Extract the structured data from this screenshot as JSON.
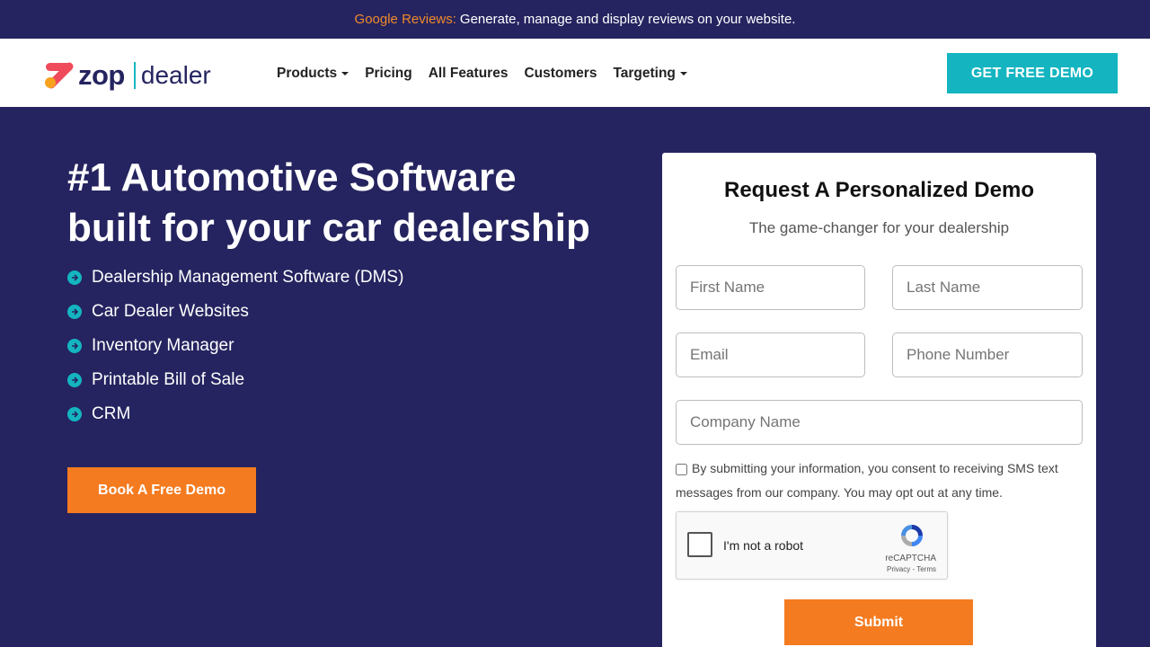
{
  "announcement": {
    "highlight": "Google Reviews:",
    "text": "Generate, manage and display reviews on your website."
  },
  "header": {
    "logo_word": "zop",
    "logo_product": "dealer",
    "menu": [
      {
        "label": "Products",
        "has_dropdown": true
      },
      {
        "label": "Pricing",
        "has_dropdown": false
      },
      {
        "label": "All Features",
        "has_dropdown": false
      },
      {
        "label": "Customers",
        "has_dropdown": false
      },
      {
        "label": "Targeting",
        "has_dropdown": true
      }
    ],
    "cta_label": "GET FREE DEMO"
  },
  "hero": {
    "title_line1": "#1 Automotive Software",
    "title_line2": "built for your car dealership",
    "features": [
      "Dealership Management Software (DMS)",
      "Car Dealer Websites",
      "Inventory Manager",
      "Printable Bill of Sale",
      "CRM"
    ],
    "button_label": "Book A Free Demo"
  },
  "form": {
    "title": "Request A Personalized Demo",
    "subtitle": "The game-changer for your dealership",
    "first_name_placeholder": "First Name",
    "last_name_placeholder": "Last Name",
    "email_placeholder": "Email",
    "phone_placeholder": "Phone Number",
    "company_placeholder": "Company Name",
    "consent_text": "By submitting your information, you consent to receiving SMS text messages from our company. You may opt out at any time.",
    "consent_checked": false,
    "recaptcha_label": "I'm not a robot",
    "recaptcha_brand": "reCAPTCHA",
    "recaptcha_terms": "Privacy - Terms",
    "submit_label": "Submit"
  },
  "colors": {
    "navy": "#252460",
    "teal": "#14b5c0",
    "orange": "#f47b20",
    "highlight": "#f08a2c"
  }
}
